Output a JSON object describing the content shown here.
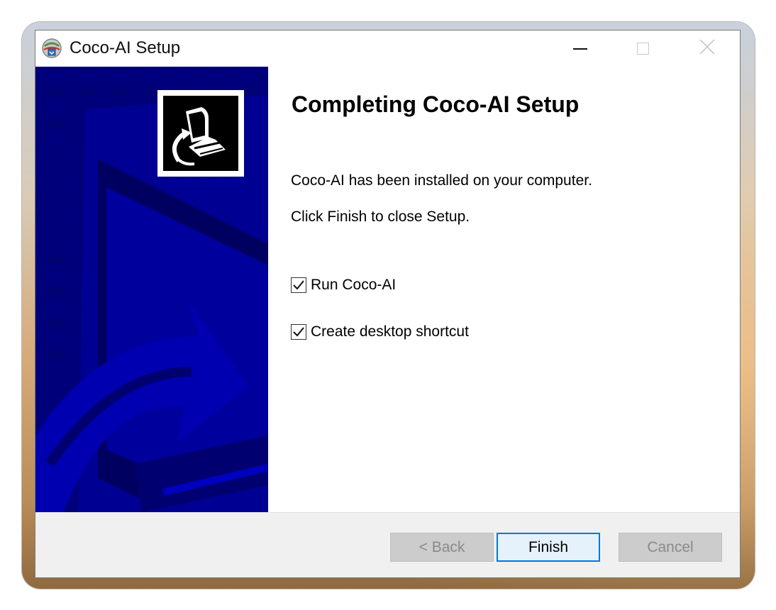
{
  "window": {
    "title": "Coco-AI Setup",
    "icon": "installer-globe-icon",
    "controls": [
      "minimize-icon",
      "maximize-icon",
      "close-icon"
    ]
  },
  "main": {
    "heading": "Completing Coco-AI Setup",
    "message_installed": "Coco-AI has been installed on your computer.",
    "message_finish": "Click Finish to close Setup.",
    "options": [
      {
        "label": "Run Coco-AI",
        "checked": true
      },
      {
        "label": "Create desktop shortcut",
        "checked": true
      }
    ]
  },
  "buttons": {
    "back": "< Back",
    "finish": "Finish",
    "cancel": "Cancel"
  },
  "colors": {
    "side_panel": "#00007f",
    "accent": "#0078d7"
  }
}
